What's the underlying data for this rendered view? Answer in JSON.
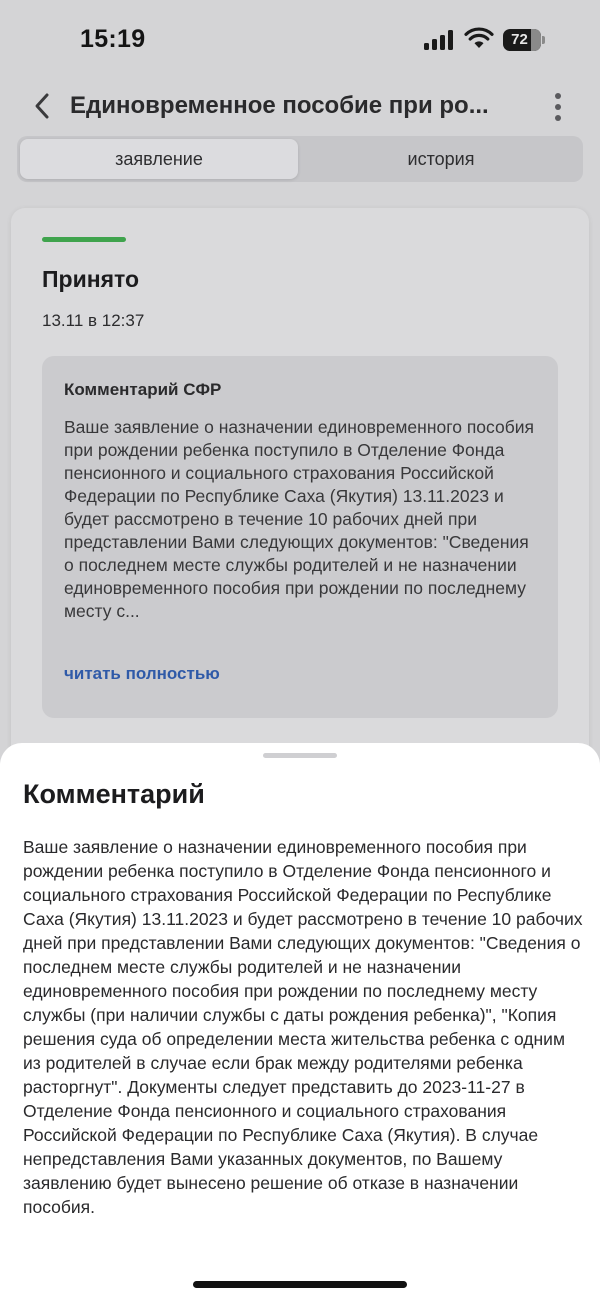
{
  "status_bar": {
    "time": "15:19",
    "battery_level": "72"
  },
  "header": {
    "title": "Единовременное пособие при ро...",
    "back_icon": "chevron-left-icon",
    "menu_icon": "more-vertical-icon"
  },
  "tabs": [
    {
      "label": "заявление",
      "active": true
    },
    {
      "label": "история",
      "active": false
    }
  ],
  "card": {
    "status_color": "#3fa34d",
    "status": "Принято",
    "date": "13.11 в 12:37",
    "comment_title": "Комментарий СФР",
    "comment_preview": "Ваше заявление о назначении единовременного пособия при рождении ребенка поступило в Отделение Фонда пенсионного и социального страхования Российской Федерации по Республике Саха (Якутия) 13.11.2023 и будет рассмотрено в течение 10 рабочих дней при представлении Вами следующих документов: \"Сведения о последнем месте службы родителей и не назначении единовременного пособия при рождении по последнему месту с...",
    "read_more": "читать полностью"
  },
  "sheet": {
    "title": "Комментарий",
    "text": "Ваше заявление о назначении единовременного пособия при рождении ребенка поступило в Отделение Фонда пенсионного и социального страхования Российской Федерации по Республике Саха (Якутия) 13.11.2023 и будет рассмотрено в течение 10 рабочих дней при представлении Вами следующих документов: \"Сведения о последнем месте службы родителей и не назначении единовременного пособия при рождении по последнему месту службы (при наличии службы с даты рождения ребенка)\", \"Копия решения суда об определении места жительства ребенка с одним из родителей в случае если брак между родителями ребенка расторгнут\". Документы следует представить до 2023-11-27 в Отделение Фонда пенсионного и социального страхования Российской Федерации по Республике Саха (Якутия). В случае непредставления Вами указанных документов, по Вашему заявлению будет вынесено решение об отказе в назначении пособия."
  }
}
